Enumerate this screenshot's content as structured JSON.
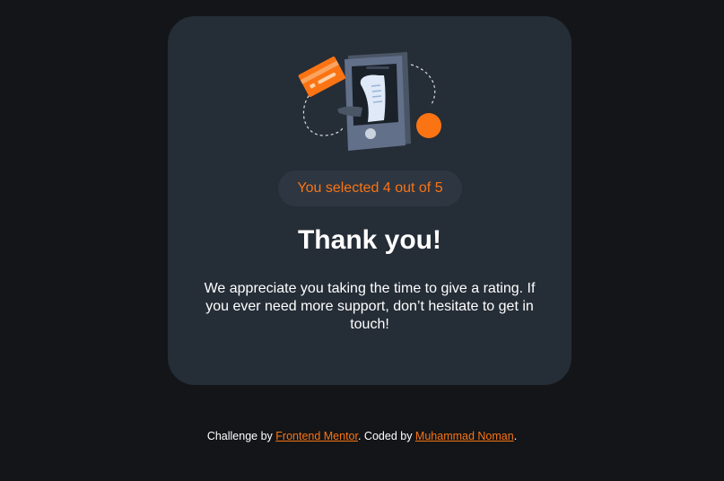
{
  "card": {
    "rating_text": "You selected 4 out of 5",
    "title": "Thank you!",
    "message": "We appreciate you taking the time to give a rating. If you ever need more support, don’t hesitate to get in touch!"
  },
  "attribution": {
    "prefix": "Challenge by ",
    "frontend_mentor": "Frontend Mentor",
    "middle": ". Coded by ",
    "author": "Muhammad Noman",
    "suffix": "."
  },
  "icons": {
    "illustration": "phone-payment-illustration"
  },
  "colors": {
    "background": "#131518",
    "card": "#252d37",
    "pill": "#2e3641",
    "accent": "#fb7413",
    "text": "#ffffff"
  }
}
